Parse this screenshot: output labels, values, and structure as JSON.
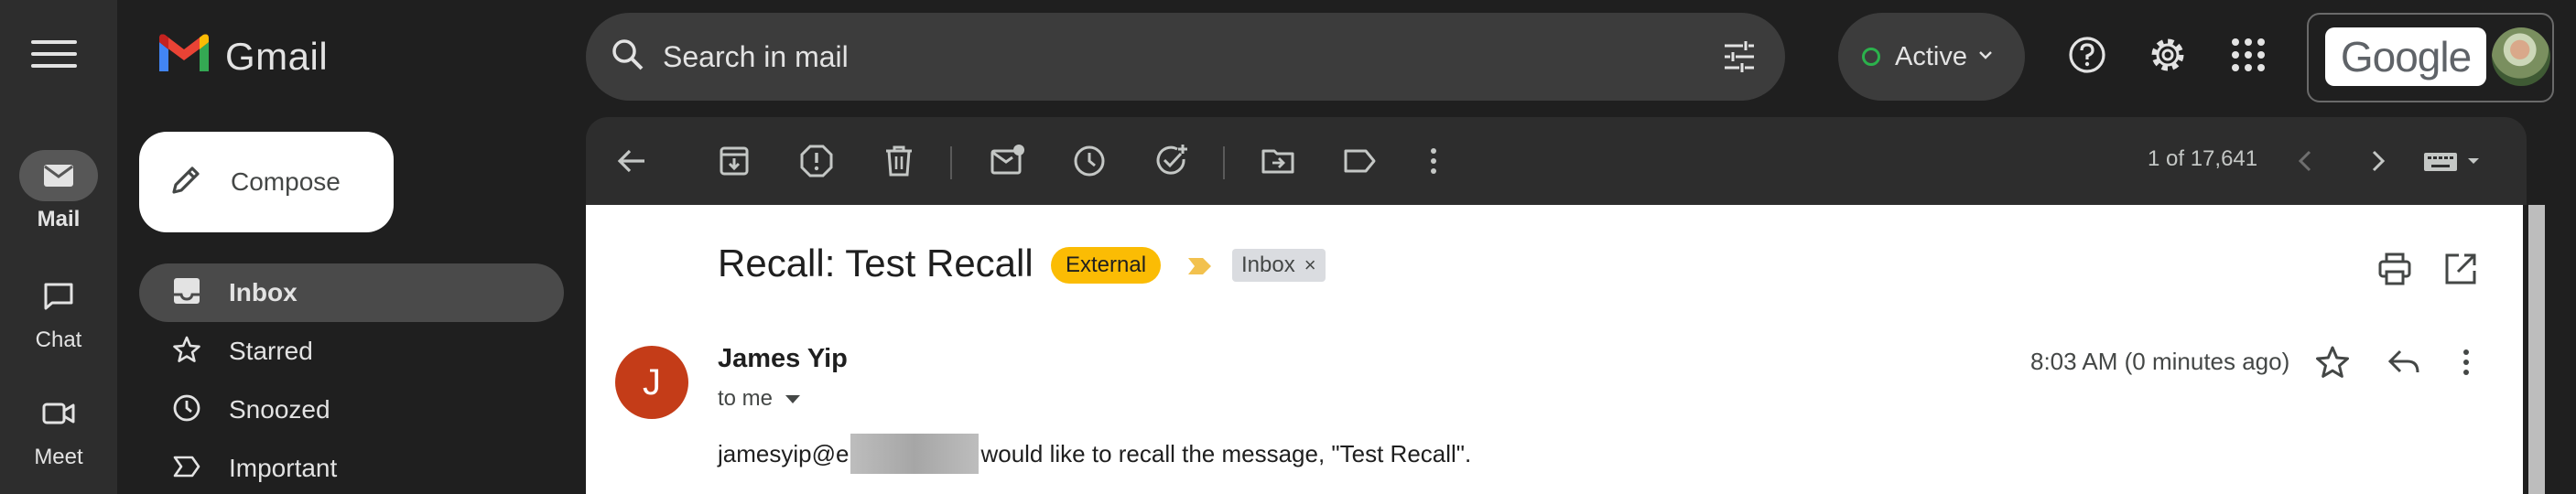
{
  "app": {
    "name": "Gmail",
    "logo_icon": "gmail-m-icon"
  },
  "rail": {
    "items": [
      {
        "label": "Mail",
        "icon": "mail-icon",
        "active": true
      },
      {
        "label": "Chat",
        "icon": "chat-icon",
        "active": false
      },
      {
        "label": "Meet",
        "icon": "video-icon",
        "active": false
      }
    ]
  },
  "compose": {
    "label": "Compose",
    "icon": "pencil-icon"
  },
  "nav": {
    "items": [
      {
        "label": "Inbox",
        "icon": "inbox-icon",
        "active": true
      },
      {
        "label": "Starred",
        "icon": "star-icon"
      },
      {
        "label": "Snoozed",
        "icon": "clock-icon"
      },
      {
        "label": "Important",
        "icon": "important-icon"
      }
    ]
  },
  "search": {
    "placeholder": "Search in mail"
  },
  "status": {
    "label": "Active",
    "color": "#2bb24c"
  },
  "account": {
    "logo_text": "Google"
  },
  "toolbar": {
    "pager": "1 of 17,641"
  },
  "message": {
    "subject": "Recall: Test Recall",
    "label_external": "External",
    "label_inbox": "Inbox",
    "label_inbox_remove": "×",
    "sender_initial": "J",
    "sender_name": "James Yip",
    "recipient": "to me",
    "timestamp": "8:03 AM (0 minutes ago)",
    "body_prefix": "jamesyip@e",
    "body_suffix": "would like to recall the message, \"Test Recall\"."
  },
  "colors": {
    "accent_external": "#fbbc04",
    "avatar_bg": "#c43c18",
    "page_bg": "#1f1f1f"
  }
}
